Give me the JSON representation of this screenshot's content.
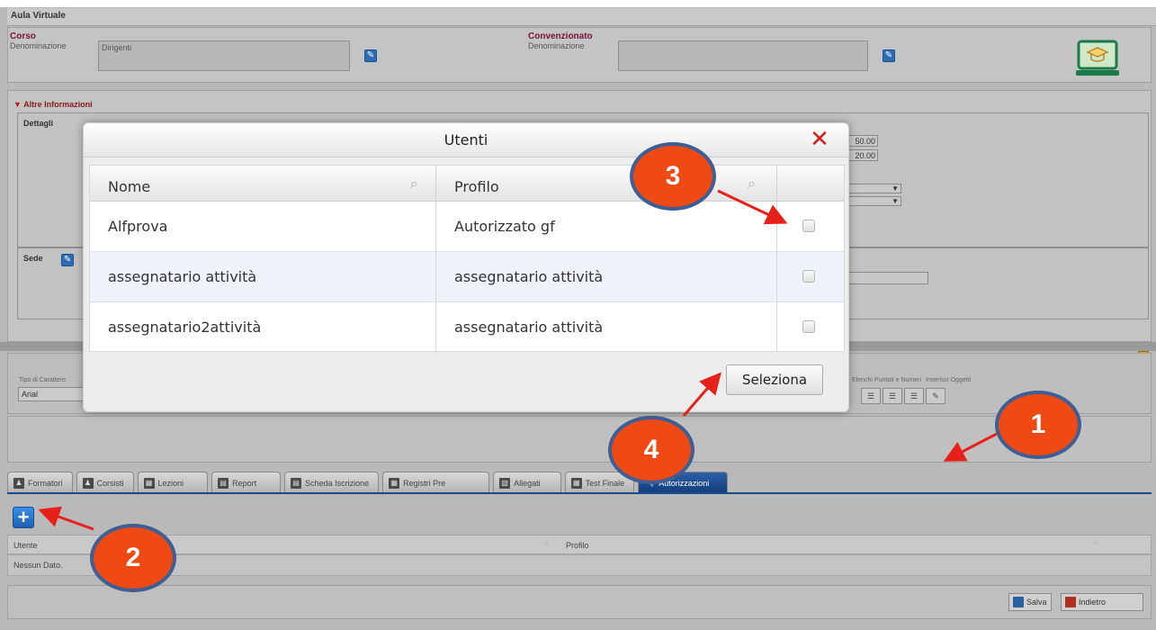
{
  "app": {
    "title": "Aula Virtuale"
  },
  "corso": {
    "section": "Corso",
    "denominazione_label": "Denominazione",
    "denominazione_value": "Dirigenti"
  },
  "convenzionato": {
    "section": "Convenzionato",
    "denominazione_label": "Denominazione",
    "denominazione_value": ""
  },
  "altre": {
    "toggle_label": "Altre Informazioni",
    "dettagli_label": "Dettagli",
    "sede_label": "Sede",
    "num1": "50.00",
    "num2": "20.00"
  },
  "editor": {
    "font_label": "Tipo di Carattere",
    "font_value": "Arial",
    "lists_label": "Elenchi Puntati e Numeri",
    "insert_label": "Inserisci Oggetti"
  },
  "tabs": [
    {
      "label": "Formatori"
    },
    {
      "label": "Corsisti"
    },
    {
      "label": "Lezioni"
    },
    {
      "label": "Report"
    },
    {
      "label": "Scheda Iscrizione"
    },
    {
      "label": "Registri Pre"
    },
    {
      "label": "Allegati"
    },
    {
      "label": "Test Finale"
    },
    {
      "label": "Autorizzazioni"
    }
  ],
  "grid": {
    "col_utente": "Utente",
    "col_profilo": "Profilo",
    "empty": "Nessun Dato."
  },
  "footer": {
    "save": "Salva",
    "back": "Indietro"
  },
  "modal": {
    "title": "Utenti",
    "col_nome": "Nome",
    "col_profilo": "Profilo",
    "rows": [
      {
        "nome": "Alfprova",
        "profilo": "Autorizzato gf"
      },
      {
        "nome": "assegnatario attività",
        "profilo": "assegnatario attività"
      },
      {
        "nome": "assegnatario2attività",
        "profilo": "assegnatario attività"
      }
    ],
    "select_button": "Seleziona"
  },
  "callouts": {
    "c1": "1",
    "c2": "2",
    "c3": "3",
    "c4": "4"
  },
  "colors": {
    "callout_fill": "#f04a14",
    "callout_border": "#3d5f96",
    "arrow": "#e8201a",
    "tab_active": "#1a4a8e"
  }
}
